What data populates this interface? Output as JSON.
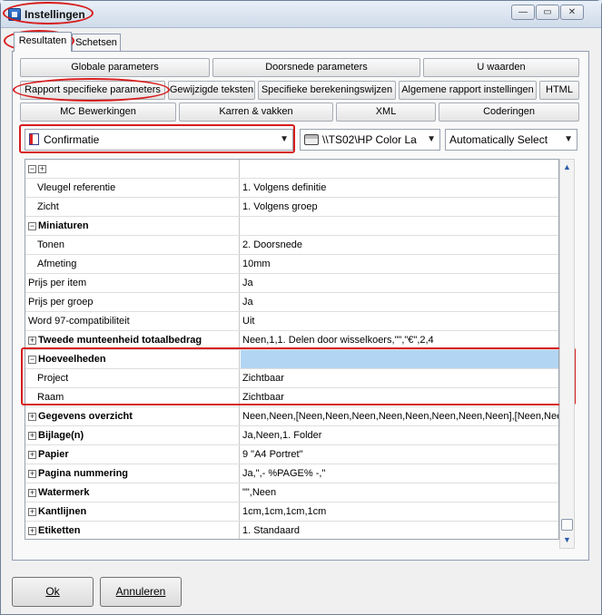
{
  "window": {
    "title": "Instellingen",
    "controls": {
      "minimize": "—",
      "restore": "▭",
      "close": "✕"
    }
  },
  "tabs": [
    {
      "label": "Resultaten",
      "active": true
    },
    {
      "label": "Schetsen",
      "active": false
    }
  ],
  "buttons_row1": [
    "Globale parameters",
    "Doorsnede parameters",
    "U waarden"
  ],
  "buttons_row2": [
    "Rapport specifieke parameters",
    "Gewijzigde teksten",
    "Specifieke berekeningswijzen",
    "Algemene rapport instellingen",
    "HTML"
  ],
  "buttons_row3": [
    "MC Bewerkingen",
    "Karren & vakken",
    "XML",
    "Coderingen"
  ],
  "report_select": {
    "value": "Confirmatie",
    "icon": "report-icon"
  },
  "printer_select": {
    "value": "\\\\TS02\\HP Color La",
    "icon": "printer-icon"
  },
  "tray_select": {
    "value": "Automatically Select"
  },
  "grid": {
    "header_expand": "⊟⊞",
    "rows": [
      {
        "name": "Vleugel referentie",
        "value": "1. Volgens definitie",
        "level": 1,
        "type": "item"
      },
      {
        "name": "Zicht",
        "value": "1. Volgens groep",
        "level": 1,
        "type": "item"
      },
      {
        "name": "Miniaturen",
        "value": "",
        "level": 0,
        "type": "group",
        "expander": "−"
      },
      {
        "name": "Tonen",
        "value": "2. Doorsnede",
        "level": 1,
        "type": "item"
      },
      {
        "name": "Afmeting",
        "value": "10mm",
        "level": 1,
        "type": "item"
      },
      {
        "name": "Prijs per item",
        "value": "Ja",
        "level": 0,
        "type": "item"
      },
      {
        "name": "Prijs per groep",
        "value": "Ja",
        "level": 0,
        "type": "item"
      },
      {
        "name": "Word 97-compatibiliteit",
        "value": "Uit",
        "level": 0,
        "type": "item"
      },
      {
        "name": "Tweede munteenheid totaalbedrag",
        "value": "Neen,1,1. Delen door wisselkoers,\"\",\"€\",2,4",
        "level": 0,
        "type": "group",
        "expander": "+"
      },
      {
        "name": "Hoeveelheden",
        "value": "",
        "level": 0,
        "type": "group",
        "expander": "−",
        "selected": true
      },
      {
        "name": "Project",
        "value": "Zichtbaar",
        "level": 1,
        "type": "item"
      },
      {
        "name": "Raam",
        "value": "Zichtbaar",
        "level": 1,
        "type": "item"
      },
      {
        "name": "Gegevens overzicht",
        "value": "Neen,Neen,[Neen,Neen,Neen,Neen,Neen,Neen,Neen,Neen],[Neen,Neen",
        "level": 0,
        "type": "group",
        "expander": "+"
      },
      {
        "name": "Bijlage(n)",
        "value": "Ja,Neen,1. Folder",
        "level": 0,
        "type": "group",
        "expander": "+"
      },
      {
        "name": "Papier",
        "value": "9 \"A4 Portret\"",
        "level": 0,
        "type": "group",
        "expander": "+"
      },
      {
        "name": "Pagina nummering",
        "value": "Ja,\",- %PAGE% -,\"",
        "level": 0,
        "type": "group",
        "expander": "+"
      },
      {
        "name": "Watermerk",
        "value": "\"\",Neen",
        "level": 0,
        "type": "group",
        "expander": "+"
      },
      {
        "name": "Kantlijnen",
        "value": "1cm,1cm,1cm,1cm",
        "level": 0,
        "type": "group",
        "expander": "+"
      },
      {
        "name": "Etiketten",
        "value": "1. Standaard",
        "level": 0,
        "type": "group",
        "expander": "+"
      }
    ]
  },
  "footer": {
    "ok": "Ok",
    "cancel": "Annuleren"
  },
  "colors": {
    "highlight": "#d71c1c",
    "selection": "#b2d5f3"
  }
}
